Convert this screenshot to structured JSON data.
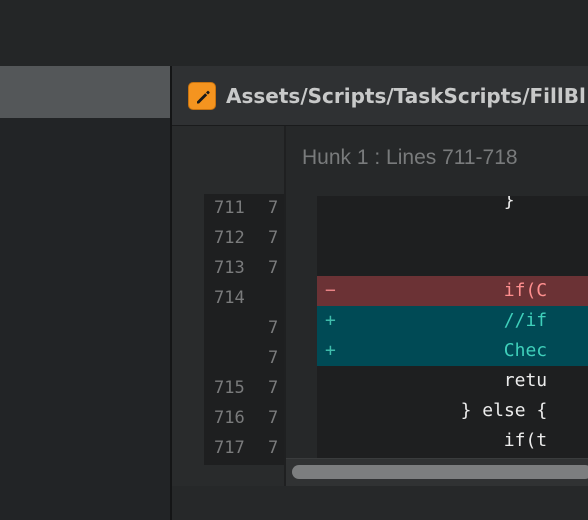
{
  "editor": {
    "file_path": "Assets/Scripts/TaskScripts/FillBl",
    "file_icon": "pencil-icon",
    "accent": "#f5941f"
  },
  "diff": {
    "hunk_title": "Hunk 1 : Lines 711-718",
    "rows": [
      {
        "old": "711",
        "new": "7",
        "type": "context",
        "marker": "",
        "indent": 8,
        "text": "}"
      },
      {
        "old": "712",
        "new": "7",
        "type": "context",
        "marker": "",
        "indent": 0,
        "text": ""
      },
      {
        "old": "713",
        "new": "7",
        "type": "context",
        "marker": "",
        "indent": 8,
        "text": ""
      },
      {
        "old": "714",
        "new": "",
        "type": "removed",
        "marker": "−",
        "indent": 8,
        "text": "if(C"
      },
      {
        "old": "",
        "new": "7",
        "type": "added",
        "marker": "+",
        "indent": 8,
        "text": "//if"
      },
      {
        "old": "",
        "new": "7",
        "type": "added",
        "marker": "+",
        "indent": 8,
        "text": "Chec"
      },
      {
        "old": "715",
        "new": "7",
        "type": "context",
        "marker": "",
        "indent": 8,
        "text": "retu"
      },
      {
        "old": "716",
        "new": "7",
        "type": "context",
        "marker": "",
        "indent": 6,
        "text": "} else {"
      },
      {
        "old": "717",
        "new": "7",
        "type": "context",
        "marker": "",
        "indent": 8,
        "text": "if(t"
      }
    ],
    "colors": {
      "removed_bg": "#6b3235",
      "added_bg": "#004a55",
      "removed_text": "#ff8f8f",
      "added_text": "#3fd0bb"
    }
  }
}
